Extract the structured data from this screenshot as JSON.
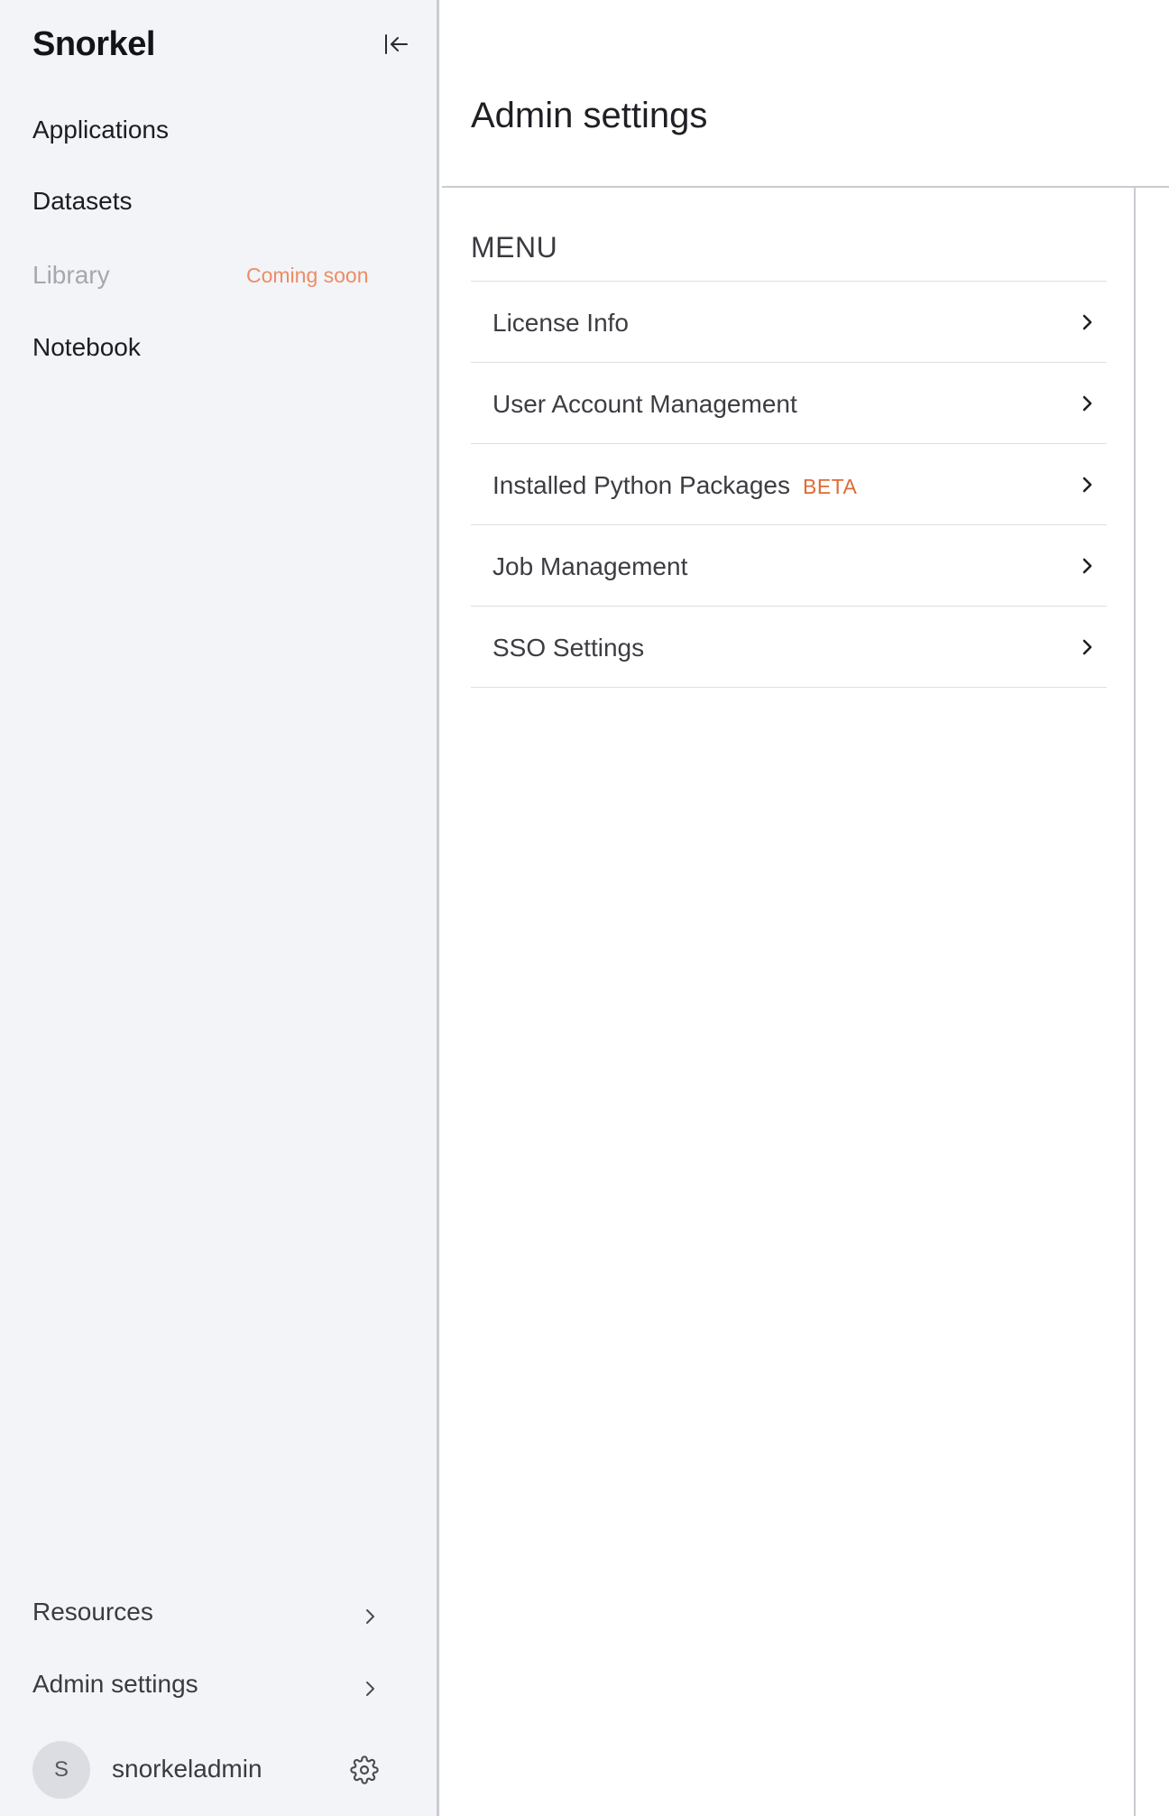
{
  "sidebar": {
    "brand": "Snorkel",
    "nav": [
      {
        "label": "Applications"
      },
      {
        "label": "Datasets"
      },
      {
        "label": "Library",
        "badge": "Coming soon",
        "disabled": true
      },
      {
        "label": "Notebook"
      }
    ],
    "bottom": [
      {
        "label": "Resources"
      },
      {
        "label": "Admin settings"
      }
    ],
    "user": {
      "initial": "S",
      "name": "snorkeladmin"
    }
  },
  "main": {
    "title": "Admin settings",
    "menu_heading": "MENU",
    "menu_items": [
      {
        "label": "License Info"
      },
      {
        "label": "User Account Management"
      },
      {
        "label": "Installed Python Packages",
        "badge": "BETA"
      },
      {
        "label": "Job Management"
      },
      {
        "label": "SSO Settings"
      }
    ]
  },
  "colors": {
    "sidebar_bg": "#f3f4f8",
    "accent_orange": "#e06a34",
    "coming_soon": "#ec8d63",
    "divider": "#c9cbd1"
  }
}
